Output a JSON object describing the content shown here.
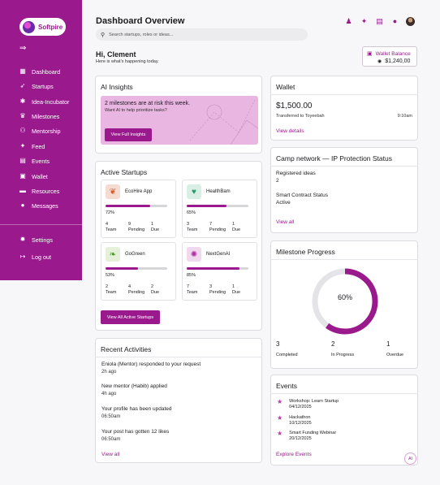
{
  "brand": {
    "name": "Softpire"
  },
  "sidebar": {
    "items": [
      {
        "label": "Dashboard"
      },
      {
        "label": "Startups"
      },
      {
        "label": "Idea-Incubator"
      },
      {
        "label": "Milestones"
      },
      {
        "label": "Mentorship"
      },
      {
        "label": "Feed"
      },
      {
        "label": "Events"
      },
      {
        "label": "Wallet"
      },
      {
        "label": "Resources"
      },
      {
        "label": "Messages"
      }
    ],
    "bottom": [
      {
        "label": "Settings"
      },
      {
        "label": "Log out"
      }
    ]
  },
  "header": {
    "title": "Dashboard Overview",
    "search_placeholder": "Search startups, roles or ideas..."
  },
  "greeting": {
    "title": "Hi, Clement",
    "subtitle": "Here is what's happening today."
  },
  "wallet_chip": {
    "label": "Wallet Balance",
    "value": "$1,240,00"
  },
  "ai_insights": {
    "title": "AI Insights",
    "headline": "2 milestones are at risk this week.",
    "sub": "Want AI to help prioritize tasks?",
    "button": "View Full Insights"
  },
  "active_startups": {
    "title": "Active Startups",
    "stat_labels": [
      "Team",
      "Pending",
      "Due"
    ],
    "items": [
      {
        "name": "EcoHire App",
        "percent_text": "72%",
        "progress": 0.72,
        "team": "4",
        "pending": "9",
        "due": "1"
      },
      {
        "name": "HealthBam",
        "percent_text": "65%",
        "progress": 0.65,
        "team": "3",
        "pending": "7",
        "due": "1"
      },
      {
        "name": "GoGreen",
        "percent_text": "53%",
        "progress": 0.53,
        "team": "2",
        "pending": "4",
        "due": "2"
      },
      {
        "name": "NextGenAI",
        "percent_text": "85%",
        "progress": 0.85,
        "team": "7",
        "pending": "3",
        "due": "1"
      }
    ],
    "button": "View All Active Startups"
  },
  "recent": {
    "title": "Recent Activities",
    "items": [
      {
        "text": "Eniola (Mentor) responded to your request",
        "time": "2h ago"
      },
      {
        "text": "New mentor (Habib) applied",
        "time": "4h ago"
      },
      {
        "text": "Your profile has been updated",
        "time": "06:50am"
      },
      {
        "text": "Your post has gotten 12 likes",
        "time": "06:50am"
      }
    ],
    "link": "View all"
  },
  "wallet": {
    "title": "Wallet",
    "amount": "$1,500.00",
    "desc": "Transferred to Toyeebah",
    "time": "9:10am",
    "link": "View details"
  },
  "camp": {
    "title": "Camp network — IP Protection Status",
    "registered_label": "Registered ideas",
    "registered_value": "2",
    "contract_label": "Smart Contract Status",
    "contract_value": "Active",
    "link": "View all"
  },
  "milestone": {
    "title": "Milestone Progress",
    "percent_text": "60%",
    "progress": 0.6,
    "stats": [
      {
        "value": "3",
        "label": "Completed"
      },
      {
        "value": "2",
        "label": "In Progress"
      },
      {
        "value": "1",
        "label": "Overdue"
      }
    ]
  },
  "events": {
    "title": "Events",
    "items": [
      {
        "name": "Workshop: Learn Startup",
        "date": "04/12/2025"
      },
      {
        "name": "Hackathon",
        "date": "10/12/2025"
      },
      {
        "name": "Smart Funding Webinar",
        "date": "20/12/2025"
      }
    ],
    "link": "Explore Events",
    "fab": "AI"
  },
  "colors": {
    "brand": "#9a1a8e",
    "insight_bg": "#e8b6e1",
    "track": "#e4e4e8"
  }
}
